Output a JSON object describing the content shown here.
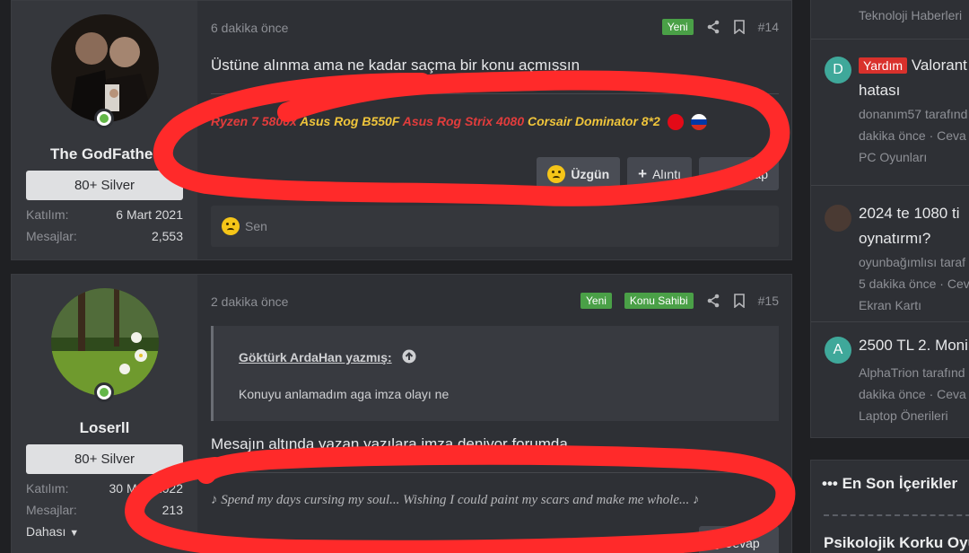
{
  "posts": [
    {
      "user": {
        "name": "The GodFather",
        "rank": "80+ Silver",
        "joined_label": "Katılım:",
        "joined": "6 Mart 2021",
        "messages_label": "Mesajlar:",
        "messages": "2,553"
      },
      "time": "6 dakika önce",
      "badges": [
        "Yeni"
      ],
      "number": "#14",
      "message": "Üstüne alınma ama ne kadar saçma bir konu açmışsın",
      "signature": {
        "p1": "Ryzen 7 5800x",
        "p2": "Asus Rog B550F",
        "p3": "Asus Rog Strix 4080",
        "p4": "Corsair Dominator 8*2"
      },
      "buttons": {
        "react": "Üzgün",
        "quote": "Alıntı",
        "reply": "Cevap"
      },
      "reactions": "Sen"
    },
    {
      "user": {
        "name": "Loserll",
        "rank": "80+ Silver",
        "joined_label": "Katılım:",
        "joined": "30 Mart 2022",
        "messages_label": "Mesajlar:",
        "messages": "213",
        "more": "Dahası"
      },
      "time": "2 dakika önce",
      "badges": [
        "Yeni",
        "Konu Sahibi"
      ],
      "number": "#15",
      "quote": {
        "author": "Göktürk ArdaHan yazmış:",
        "text": "Konuyu anlamadım aga imza olayı ne"
      },
      "message": "Mesajın altında yazan yazılara imza deniyor forumda",
      "signature": "♪ Spend my days cursing my soul... Wishing I could paint my scars and make me whole... ♪",
      "buttons": {
        "reply": "Cevap"
      }
    }
  ],
  "sidebar": {
    "items": [
      {
        "meta1": "Teknoloji Haberleri"
      },
      {
        "avatar": "D",
        "avatar_color": "#3fa89a",
        "tag": "Yardım",
        "title1": "Valorant",
        "title2": "hatası",
        "meta1": "donanım57 tarafınd",
        "meta2": "dakika önce · Ceva",
        "meta3": "PC Oyunları"
      },
      {
        "title1": "2024 te 1080 ti",
        "title2": "oynatırmı?",
        "meta1": "oyunbağımlısı taraf",
        "meta2": "5 dakika önce · Cev",
        "meta3": "Ekran Kartı"
      },
      {
        "avatar": "A",
        "avatar_color": "#3fa89a",
        "title1": "2500 TL 2. Moni",
        "meta1": "AlphaTrion tarafınd",
        "meta2": "dakika önce · Ceva",
        "meta3": "Laptop Önerileri"
      }
    ],
    "latest_heading": "En Son İçerikler",
    "latest_item": "Psikolojik Korku Oyu"
  },
  "colors": {
    "scribble": "#ff2a2a",
    "badge_green": "#4aa047",
    "tag_red": "#d9312c"
  }
}
